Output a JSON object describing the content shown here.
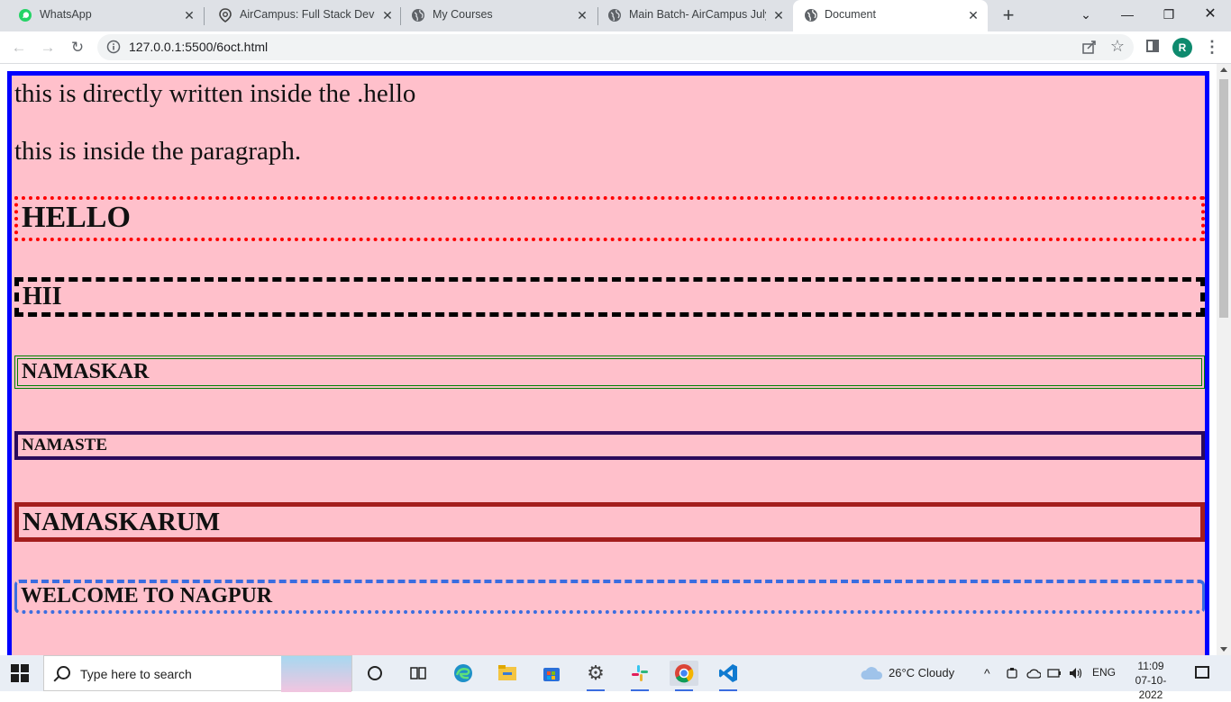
{
  "browser": {
    "tabs": [
      {
        "title": "WhatsApp",
        "icon": "whatsapp-icon"
      },
      {
        "title": "AirCampus: Full Stack Develo",
        "icon": "aircampus-icon"
      },
      {
        "title": "My Courses",
        "icon": "globe-icon"
      },
      {
        "title": "Main Batch- AirCampus July-",
        "icon": "globe-icon"
      },
      {
        "title": "Document",
        "icon": "globe-icon"
      }
    ],
    "new_tab": "+",
    "url": "127.0.0.1:5500/6oct.html",
    "profile_initial": "R"
  },
  "page": {
    "direct_text": "this is directly written inside the .hello",
    "paragraph": "this is inside the paragraph.",
    "boxes": [
      {
        "text": "HELLO",
        "border_color": "#ff0000"
      },
      {
        "text": "HII",
        "border_color": "#000000"
      },
      {
        "text": "NAMASKAR",
        "border_color": "#008000"
      },
      {
        "text": "NAMASTE",
        "border_color": "#2b0b5c"
      },
      {
        "text": "NAMASKARUM",
        "border_color": "#a31d1d"
      },
      {
        "text": "WELCOME TO NAGPUR",
        "border_color": "#3a6de0"
      }
    ],
    "background": "#ffc0cb",
    "outer_border": "#0000ff"
  },
  "taskbar": {
    "search_placeholder": "Type here to search",
    "weather": "26°C  Cloudy",
    "language": "ENG",
    "time": "11:09",
    "date": "07-10-2022"
  }
}
